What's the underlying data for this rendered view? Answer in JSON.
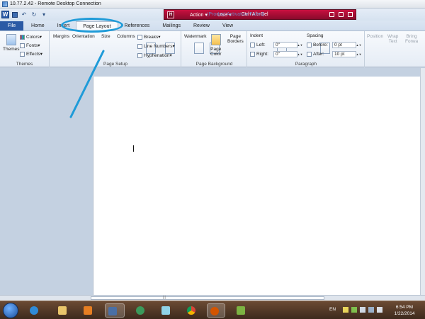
{
  "window": {
    "title": "10.77.2.42 - Remote Desktop Connection"
  },
  "rdbar": {
    "action": "Action",
    "usb": "USB",
    "cad": "Ctrl+Alt+Del",
    "ghost": "(Product Activation Failed)"
  },
  "tabs": [
    {
      "label": "File"
    },
    {
      "label": "Home"
    },
    {
      "label": "Insert"
    },
    {
      "label": "Page Layout"
    },
    {
      "label": "References"
    },
    {
      "label": "Mailings"
    },
    {
      "label": "Review"
    },
    {
      "label": "View"
    }
  ],
  "ribbon": {
    "themes": {
      "themes": "Themes",
      "colors": "Colors",
      "fonts": "Fonts",
      "effects": "Effects",
      "label": "Themes"
    },
    "page_setup": {
      "margins": "Margins",
      "orientation": "Orientation",
      "size": "Size",
      "columns": "Columns",
      "breaks": "Breaks",
      "line_numbers": "Line Numbers",
      "hyphenation": "Hyphenation",
      "label": "Page Setup"
    },
    "page_background": {
      "watermark": "Watermark",
      "page_color_1": "Page",
      "page_color_2": "Color",
      "page_borders_1": "Page",
      "page_borders_2": "Borders",
      "label": "Page Background"
    },
    "paragraph": {
      "indent": "Indent",
      "left": "Left:",
      "left_val": "0\"",
      "right": "Right:",
      "right_val": "0\"",
      "spacing": "Spacing",
      "before": "Before:",
      "before_val": "0 pt",
      "after": "After:",
      "after_val": "10 pt",
      "label": "Paragraph"
    },
    "arrange": {
      "position": "Position",
      "wrap_1": "Wrap",
      "wrap_2": "Text",
      "bring_1": "Bring",
      "bring_2": "Forwa"
    }
  },
  "taskbar": {
    "lang": "EN",
    "time": "6:54 PM",
    "date": "1/22/2014"
  }
}
